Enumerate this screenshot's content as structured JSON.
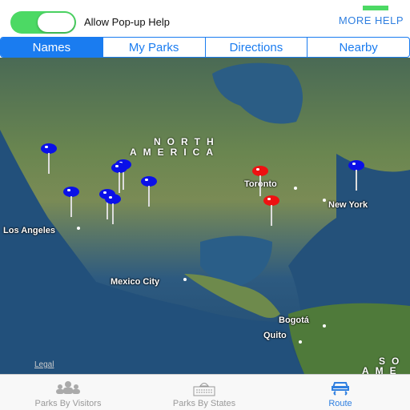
{
  "header": {
    "toggle_label": "Allow Pop-up Help",
    "toggle_on": true,
    "more_help": "MORE HELP"
  },
  "segments": [
    {
      "label": "Names",
      "active": true
    },
    {
      "label": "My Parks",
      "active": false
    },
    {
      "label": "Directions",
      "active": false
    },
    {
      "label": "Nearby",
      "active": false
    }
  ],
  "map": {
    "regions": {
      "north_america_1": "NORTH",
      "north_america_2": "AMERICA",
      "south_america_1": "SO",
      "south_america_2": "AME"
    },
    "cities": [
      "Los Angeles",
      "Toronto",
      "New York",
      "Mexico City",
      "Bogotá",
      "Quito"
    ],
    "legal": "Legal",
    "pin_colors": {
      "blue": "#0a10e8",
      "red": "#ee1111"
    }
  },
  "tabbar": [
    {
      "label": "Parks By Visitors",
      "icon": "people-icon",
      "active": false
    },
    {
      "label": "Parks By States",
      "icon": "capitol-building-icon",
      "active": false
    },
    {
      "label": "Route",
      "icon": "car-route-icon",
      "active": true
    }
  ]
}
